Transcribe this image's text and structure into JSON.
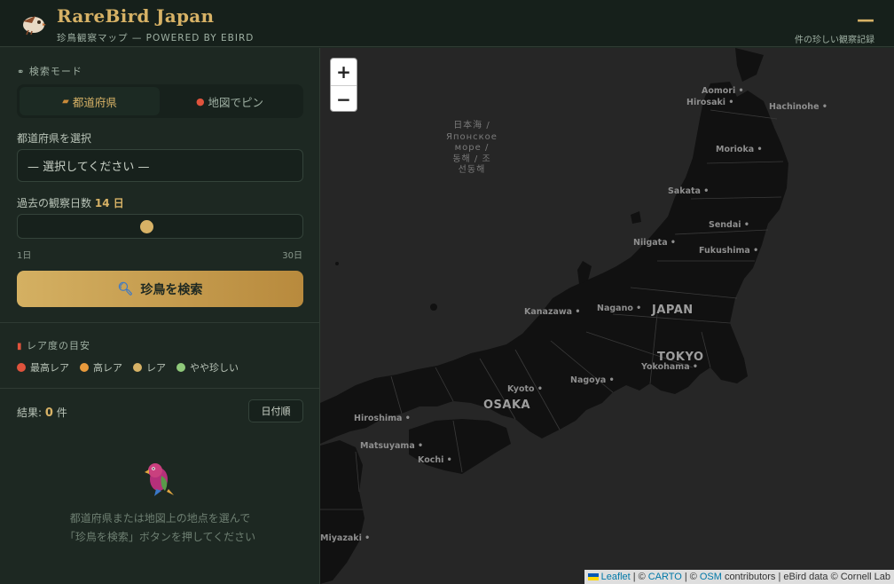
{
  "header": {
    "title": "RareBird Japan",
    "subtitle": "珍鳥観察マップ — POWERED BY EBIRD",
    "count_value": "—",
    "count_label": "件の珍しい観察記録"
  },
  "sidebar": {
    "mode_label": "検索モード",
    "mode_prefecture": "都道府県",
    "mode_pin": "地図でピン",
    "prefecture_label": "都道府県を選択",
    "prefecture_value": "— 選択してください —",
    "days_label": "過去の観察日数",
    "days_value": "14 日",
    "days_fraction": 0.45,
    "days_min": "1日",
    "days_max": "30日",
    "search_button": "珍鳥を検索",
    "legend_title": "レア度の目安",
    "legend": [
      {
        "label": "最高レア",
        "color": "#e0533c"
      },
      {
        "label": "高レア",
        "color": "#e89a3c"
      },
      {
        "label": "レア",
        "color": "#d7b266"
      },
      {
        "label": "やや珍しい",
        "color": "#8fc97a"
      }
    ],
    "results_prefix": "結果:",
    "results_count": "0",
    "results_suffix": "件",
    "sort_button": "日付順",
    "empty_line1": "都道府県または地図上の地点を選んで",
    "empty_line2": "「珍鳥を検索」ボタンを押してください"
  },
  "map": {
    "zoom_in": "+",
    "zoom_out": "−",
    "sea_lines": [
      "日本海 /",
      "Японское",
      "море /",
      "동해 / 조",
      "선동해"
    ],
    "cities": [
      {
        "name": "Aomori",
        "cls": ""
      },
      {
        "name": "Hirosaki",
        "cls": ""
      },
      {
        "name": "Hachinohe",
        "cls": ""
      },
      {
        "name": "Morioka",
        "cls": ""
      },
      {
        "name": "Sakata",
        "cls": ""
      },
      {
        "name": "Sendai",
        "cls": ""
      },
      {
        "name": "Niigata",
        "cls": ""
      },
      {
        "name": "Fukushima",
        "cls": ""
      },
      {
        "name": "Nagano",
        "cls": ""
      },
      {
        "name": "Kanazawa",
        "cls": ""
      },
      {
        "name": "JAPAN",
        "cls": "big"
      },
      {
        "name": "TOKYO",
        "cls": "big"
      },
      {
        "name": "Yokohama",
        "cls": ""
      },
      {
        "name": "Nagoya",
        "cls": ""
      },
      {
        "name": "Kyoto",
        "cls": ""
      },
      {
        "name": "OSAKA",
        "cls": "big"
      },
      {
        "name": "Hiroshima",
        "cls": ""
      },
      {
        "name": "Matsuyama",
        "cls": ""
      },
      {
        "name": "Kochi",
        "cls": ""
      },
      {
        "name": "Miyazaki",
        "cls": ""
      }
    ],
    "attribution": {
      "leaflet": "Leaflet",
      "sep1": "| ©",
      "carto": "CARTO",
      "sep2": "| ©",
      "osm": "OSM",
      "rest": "contributors | eBird data © Cornell Lab"
    }
  },
  "colors": {
    "accent": "#d7b266",
    "background": "#1d2822",
    "map": "#262626",
    "land": "#111111"
  }
}
